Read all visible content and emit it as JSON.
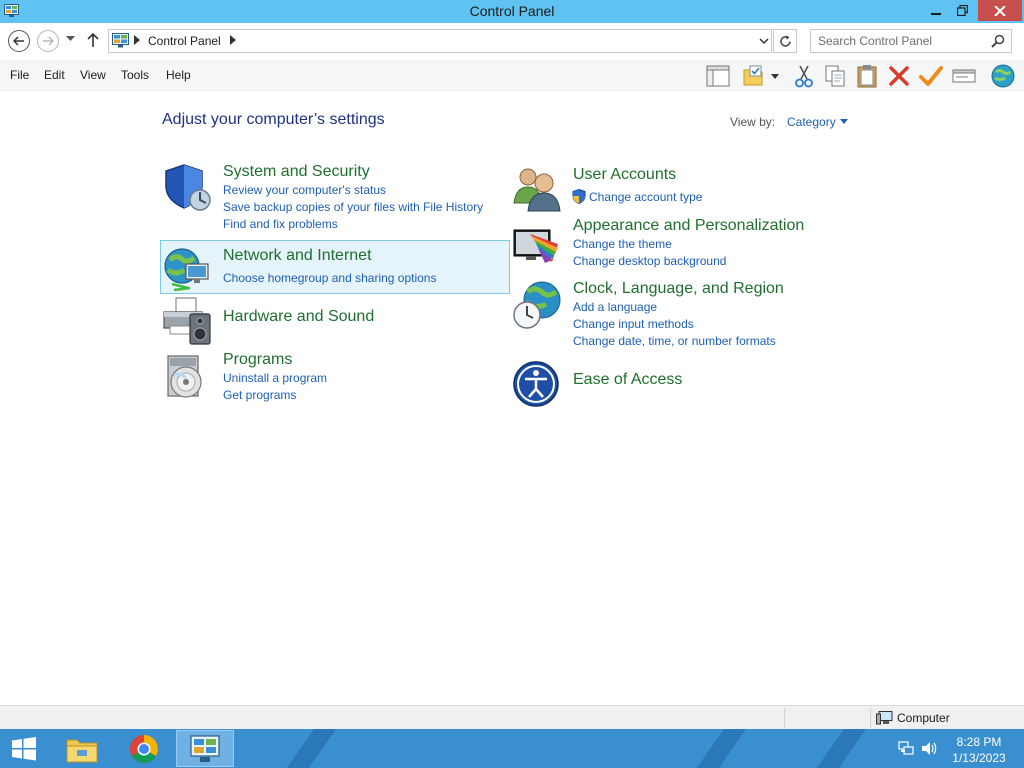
{
  "window": {
    "title": "Control Panel"
  },
  "address_bar": {
    "crumbs": [
      "Control Panel"
    ]
  },
  "search": {
    "placeholder": "Search Control Panel"
  },
  "menu": {
    "items": [
      "File",
      "Edit",
      "View",
      "Tools",
      "Help"
    ]
  },
  "toolbar": {
    "icons": [
      "layout-icon",
      "folder-check-icon",
      "dropdown-arrow-icon",
      "cut-icon",
      "copy-icon",
      "paste-icon",
      "delete-icon",
      "checkmark-icon",
      "properties-icon",
      "globe-icon"
    ]
  },
  "content": {
    "heading": "Adjust your computer’s settings",
    "view_by_label": "View by:",
    "view_by_value": "Category",
    "categories_left": [
      {
        "title": "System and Security",
        "icon": "shield-icon",
        "links": [
          "Review your computer's status",
          "Save backup copies of your files with File History",
          "Find and fix problems"
        ]
      },
      {
        "title": "Network and Internet",
        "icon": "network-globe-icon",
        "links": [
          "Choose homegroup and sharing options"
        ]
      },
      {
        "title": "Hardware and Sound",
        "icon": "printer-speaker-icon",
        "links": []
      },
      {
        "title": "Programs",
        "icon": "programs-disc-icon",
        "links": [
          "Uninstall a program",
          "Get programs"
        ]
      }
    ],
    "categories_right": [
      {
        "title": "User Accounts",
        "icon": "users-icon",
        "links": [
          "Change account type"
        ]
      },
      {
        "title": "Appearance and Personalization",
        "icon": "monitor-palette-icon",
        "links": [
          "Change the theme",
          "Change desktop background"
        ]
      },
      {
        "title": "Clock, Language, and Region",
        "icon": "clock-globe-icon",
        "links": [
          "Add a language",
          "Change input methods",
          "Change date, time, or number formats"
        ]
      },
      {
        "title": "Ease of Access",
        "icon": "ease-of-access-icon",
        "links": []
      }
    ]
  },
  "status_bar": {
    "location": "Computer"
  },
  "taskbar": {
    "apps": [
      "start-icon",
      "file-explorer-icon",
      "chrome-icon",
      "control-panel-icon"
    ],
    "time": "8:28 PM",
    "date": "1/13/2023"
  },
  "colors": {
    "title_bar": "#5fc2f0",
    "close_button": "#c7504c",
    "heading_blue": "#1e3287",
    "category_green": "#1f6f2f",
    "link_blue": "#1e5fb4",
    "selection_bg": "#e5f3fb",
    "taskbar": "#3a8fd1"
  }
}
